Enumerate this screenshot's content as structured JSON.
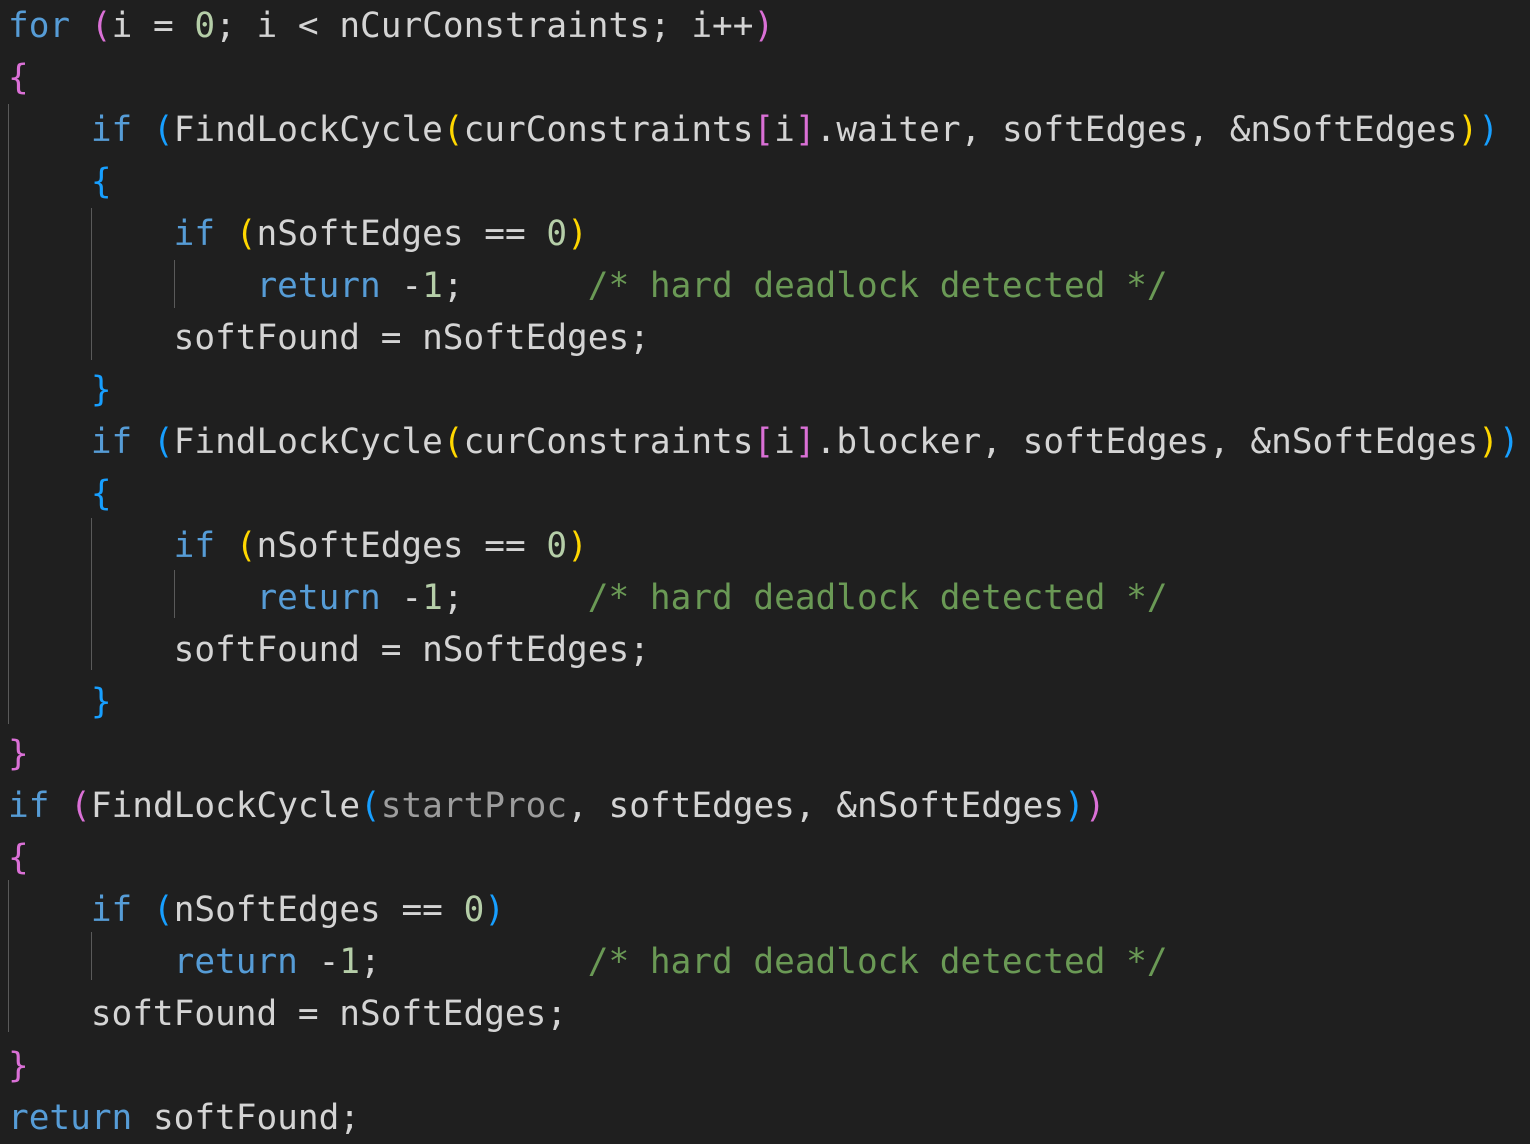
{
  "editor": {
    "lines": [
      {
        "tokens": [
          {
            "t": "for",
            "c": "kw"
          },
          {
            "t": " ",
            "c": "var"
          },
          {
            "t": "(",
            "c": "b1"
          },
          {
            "t": "i = ",
            "c": "var"
          },
          {
            "t": "0",
            "c": "num"
          },
          {
            "t": "; i < nCurConstraints; i++",
            "c": "var"
          },
          {
            "t": ")",
            "c": "b1"
          }
        ]
      },
      {
        "tokens": [
          {
            "t": "{",
            "c": "b1"
          }
        ]
      },
      {
        "tokens": [
          {
            "t": "    ",
            "c": "var"
          },
          {
            "t": "if",
            "c": "kw"
          },
          {
            "t": " ",
            "c": "var"
          },
          {
            "t": "(",
            "c": "b3"
          },
          {
            "t": "FindLockCycle",
            "c": "var"
          },
          {
            "t": "(",
            "c": "b2"
          },
          {
            "t": "curConstraints",
            "c": "var"
          },
          {
            "t": "[",
            "c": "b1"
          },
          {
            "t": "i",
            "c": "var"
          },
          {
            "t": "]",
            "c": "b1"
          },
          {
            "t": ".waiter, softEdges, &nSoftEdges",
            "c": "var"
          },
          {
            "t": ")",
            "c": "b2"
          },
          {
            "t": ")",
            "c": "b3"
          }
        ]
      },
      {
        "tokens": [
          {
            "t": "    ",
            "c": "var"
          },
          {
            "t": "{",
            "c": "b3"
          }
        ]
      },
      {
        "tokens": [
          {
            "t": "        ",
            "c": "var"
          },
          {
            "t": "if",
            "c": "kw"
          },
          {
            "t": " ",
            "c": "var"
          },
          {
            "t": "(",
            "c": "b2"
          },
          {
            "t": "nSoftEdges == ",
            "c": "var"
          },
          {
            "t": "0",
            "c": "num"
          },
          {
            "t": ")",
            "c": "b2"
          }
        ]
      },
      {
        "tokens": [
          {
            "t": "            ",
            "c": "var"
          },
          {
            "t": "return",
            "c": "ret"
          },
          {
            "t": " -",
            "c": "var"
          },
          {
            "t": "1",
            "c": "num"
          },
          {
            "t": ";      ",
            "c": "var"
          },
          {
            "t": "/* hard deadlock detected */",
            "c": "cmt"
          }
        ]
      },
      {
        "tokens": [
          {
            "t": "        softFound = nSoftEdges;",
            "c": "var"
          }
        ]
      },
      {
        "tokens": [
          {
            "t": "    ",
            "c": "var"
          },
          {
            "t": "}",
            "c": "b3"
          }
        ]
      },
      {
        "tokens": [
          {
            "t": "    ",
            "c": "var"
          },
          {
            "t": "if",
            "c": "kw"
          },
          {
            "t": " ",
            "c": "var"
          },
          {
            "t": "(",
            "c": "b3"
          },
          {
            "t": "FindLockCycle",
            "c": "var"
          },
          {
            "t": "(",
            "c": "b2"
          },
          {
            "t": "curConstraints",
            "c": "var"
          },
          {
            "t": "[",
            "c": "b1"
          },
          {
            "t": "i",
            "c": "var"
          },
          {
            "t": "]",
            "c": "b1"
          },
          {
            "t": ".blocker, softEdges, &nSoftEdges",
            "c": "var"
          },
          {
            "t": ")",
            "c": "b2"
          },
          {
            "t": ")",
            "c": "b3"
          }
        ]
      },
      {
        "tokens": [
          {
            "t": "    ",
            "c": "var"
          },
          {
            "t": "{",
            "c": "b3"
          }
        ]
      },
      {
        "tokens": [
          {
            "t": "        ",
            "c": "var"
          },
          {
            "t": "if",
            "c": "kw"
          },
          {
            "t": " ",
            "c": "var"
          },
          {
            "t": "(",
            "c": "b2"
          },
          {
            "t": "nSoftEdges == ",
            "c": "var"
          },
          {
            "t": "0",
            "c": "num"
          },
          {
            "t": ")",
            "c": "b2"
          }
        ]
      },
      {
        "tokens": [
          {
            "t": "            ",
            "c": "var"
          },
          {
            "t": "return",
            "c": "ret"
          },
          {
            "t": " -",
            "c": "var"
          },
          {
            "t": "1",
            "c": "num"
          },
          {
            "t": ";      ",
            "c": "var"
          },
          {
            "t": "/* hard deadlock detected */",
            "c": "cmt"
          }
        ]
      },
      {
        "tokens": [
          {
            "t": "        softFound = nSoftEdges;",
            "c": "var"
          }
        ]
      },
      {
        "tokens": [
          {
            "t": "    ",
            "c": "var"
          },
          {
            "t": "}",
            "c": "b3"
          }
        ]
      },
      {
        "tokens": [
          {
            "t": "}",
            "c": "b1"
          }
        ]
      },
      {
        "tokens": [
          {
            "t": "if",
            "c": "kw"
          },
          {
            "t": " ",
            "c": "var"
          },
          {
            "t": "(",
            "c": "b1"
          },
          {
            "t": "FindLockCycle",
            "c": "var"
          },
          {
            "t": "(",
            "c": "b3"
          },
          {
            "t": "startProc",
            "c": "dim"
          },
          {
            "t": ", softEdges, &nSoftEdges",
            "c": "var"
          },
          {
            "t": ")",
            "c": "b3"
          },
          {
            "t": ")",
            "c": "b1"
          }
        ]
      },
      {
        "tokens": [
          {
            "t": "{",
            "c": "b1"
          }
        ]
      },
      {
        "tokens": [
          {
            "t": "    ",
            "c": "var"
          },
          {
            "t": "if",
            "c": "kw"
          },
          {
            "t": " ",
            "c": "var"
          },
          {
            "t": "(",
            "c": "b3"
          },
          {
            "t": "nSoftEdges == ",
            "c": "var"
          },
          {
            "t": "0",
            "c": "num"
          },
          {
            "t": ")",
            "c": "b3"
          }
        ]
      },
      {
        "tokens": [
          {
            "t": "        ",
            "c": "var"
          },
          {
            "t": "return",
            "c": "ret"
          },
          {
            "t": " -",
            "c": "var"
          },
          {
            "t": "1",
            "c": "num"
          },
          {
            "t": ";          ",
            "c": "var"
          },
          {
            "t": "/* hard deadlock detected */",
            "c": "cmt"
          }
        ]
      },
      {
        "tokens": [
          {
            "t": "    softFound = nSoftEdges;",
            "c": "var"
          }
        ]
      },
      {
        "tokens": [
          {
            "t": "}",
            "c": "b1"
          }
        ]
      },
      {
        "tokens": [
          {
            "t": "return",
            "c": "ret"
          },
          {
            "t": " softFound;",
            "c": "var"
          }
        ]
      }
    ]
  }
}
